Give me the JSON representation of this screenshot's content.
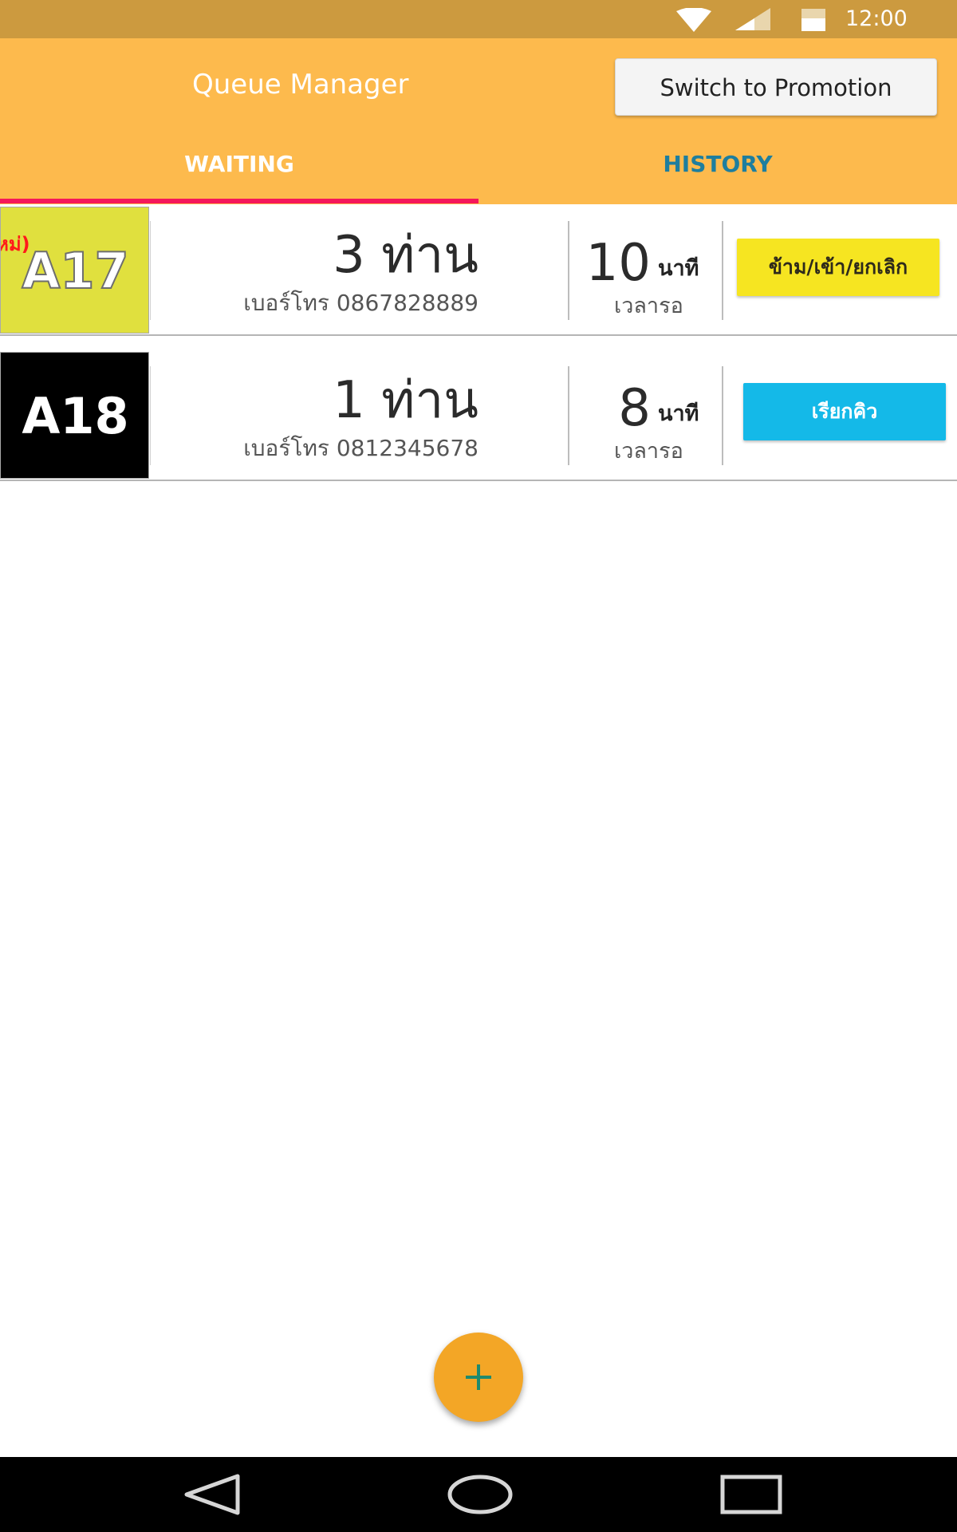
{
  "status_bar": {
    "time": "12:00",
    "icons": [
      "wifi-icon",
      "signal-icon",
      "battery-icon"
    ],
    "background": "#cc9a3f"
  },
  "app_bar": {
    "title": "Queue Manager",
    "switch_label": "Switch to Promotion",
    "background": "#fdba4d",
    "tabs": [
      {
        "label": "WAITING",
        "active": true
      },
      {
        "label": "HISTORY",
        "active": false
      }
    ],
    "indicator_color": "#f5175a"
  },
  "queue": [
    {
      "code": "A17",
      "new_tag": "หม่)",
      "guests": "3 ท่าน",
      "phone_label": "เบอร์โทร",
      "phone": "0867828889",
      "wait_number": "10",
      "wait_unit": "นาที",
      "wait_label": "เวลารอ",
      "action_label": "ข้าม/เข้า/ยกเลิก",
      "tile_color": "#e0e03e",
      "action_color": "#f6e521"
    },
    {
      "code": "A18",
      "guests": "1 ท่าน",
      "phone_label": "เบอร์โทร",
      "phone": "0812345678",
      "wait_number": "8",
      "wait_unit": "นาที",
      "wait_label": "เวลารอ",
      "action_label": "เรียกคิว",
      "tile_color": "#000000",
      "action_color": "#14b9e8"
    }
  ],
  "fab": {
    "icon": "plus-icon",
    "color": "#f3a626"
  },
  "nav_bar": {
    "icons": [
      "back-icon",
      "home-icon",
      "recents-icon"
    ]
  }
}
